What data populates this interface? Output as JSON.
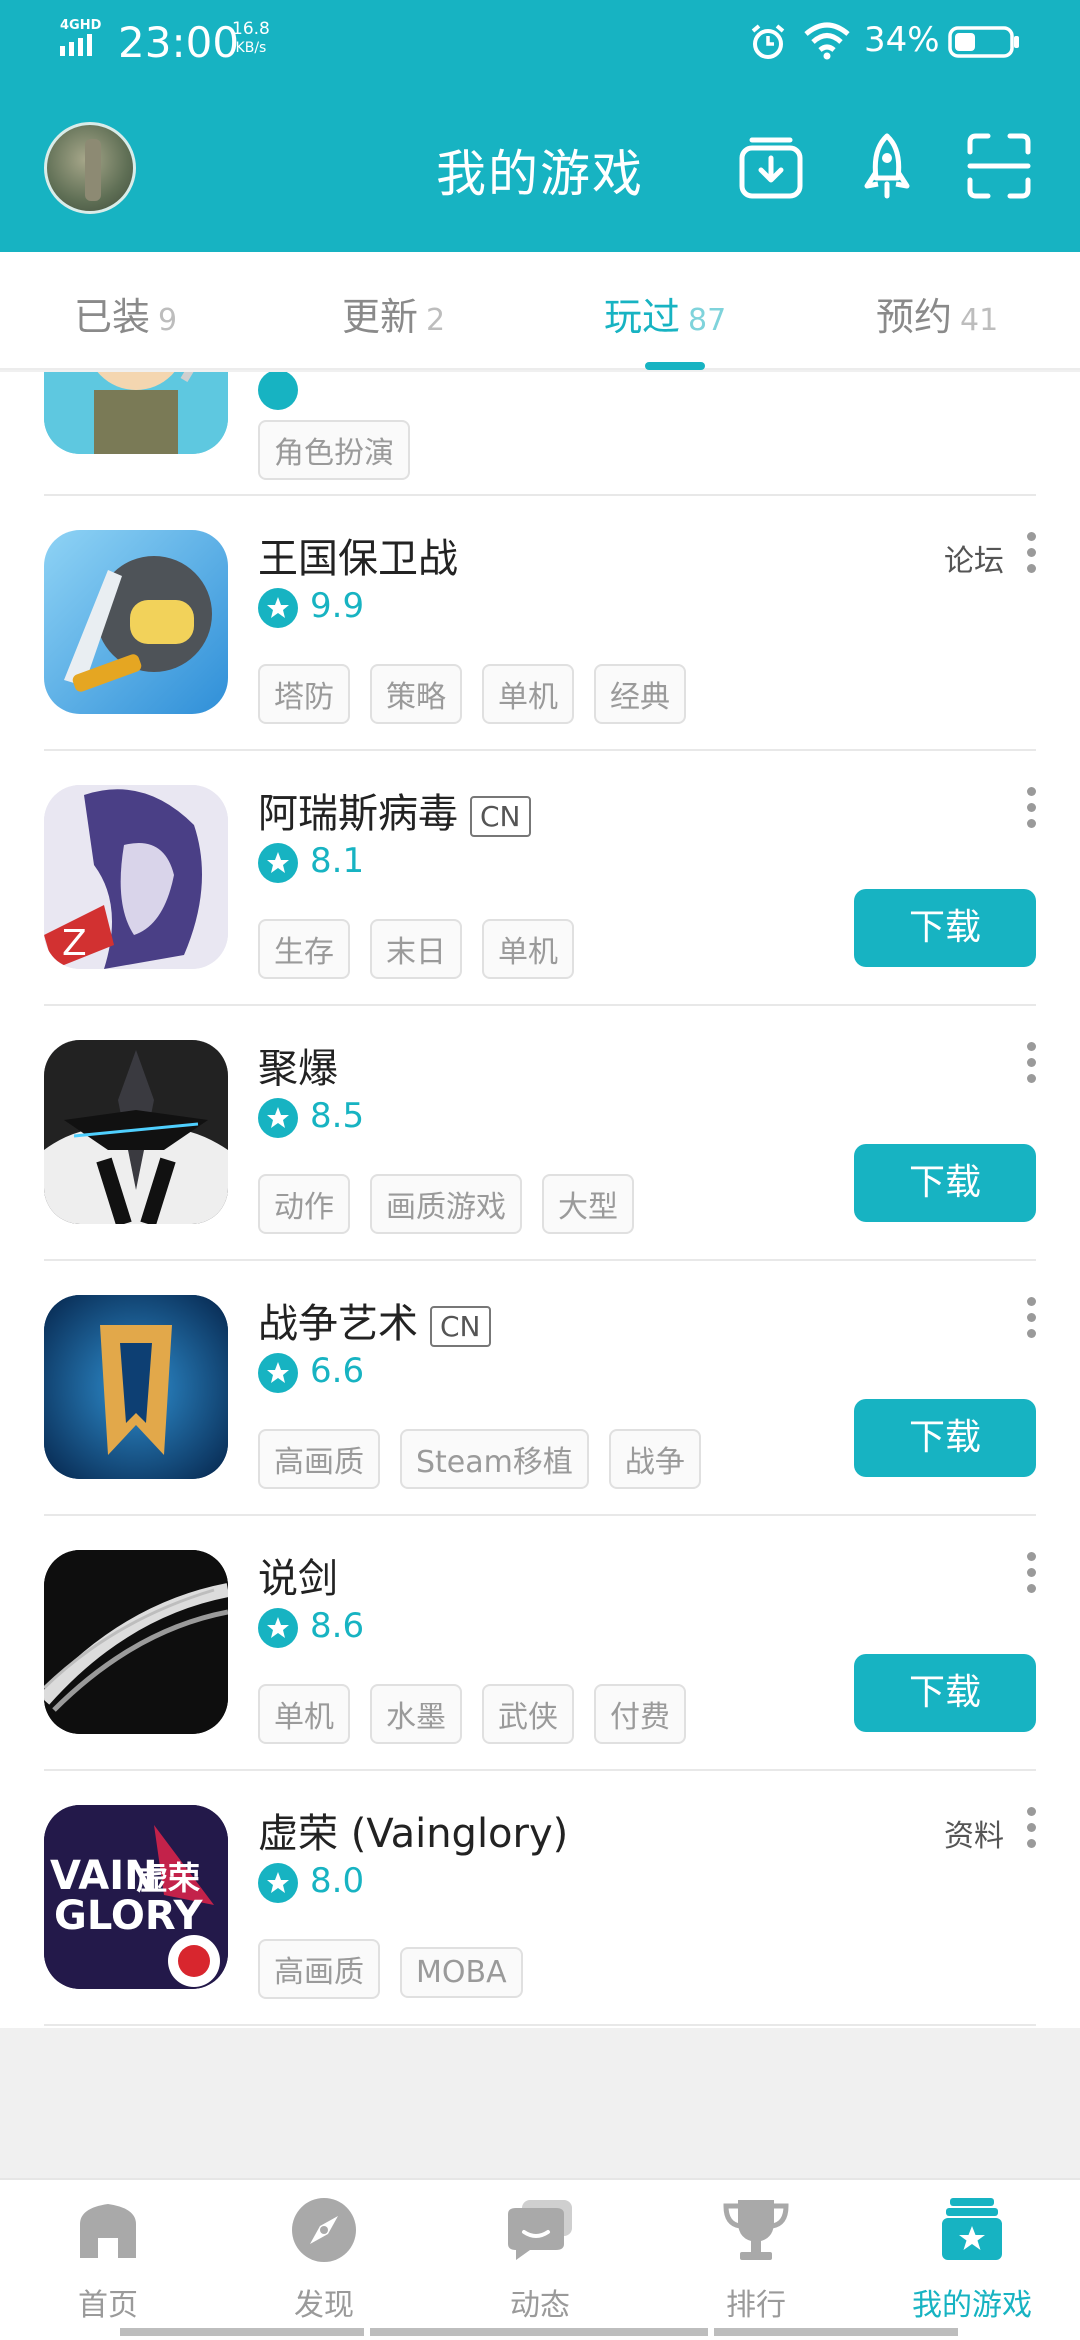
{
  "status_bar": {
    "network": "4GHD",
    "time": "23:00",
    "speed_value": "16.8",
    "speed_unit": "KB/s",
    "battery": "34%"
  },
  "header": {
    "title": "我的游戏"
  },
  "tabs": [
    {
      "label": "已装",
      "count": "9"
    },
    {
      "label": "更新",
      "count": "2"
    },
    {
      "label": "玩过",
      "count": "87"
    },
    {
      "label": "预约",
      "count": "41"
    }
  ],
  "list": {
    "partial_item": {
      "tags": [
        "角色扮演"
      ]
    },
    "items": [
      {
        "name": "王国保卫战",
        "cn": "",
        "rating": "9.9",
        "tags": [
          "塔防",
          "策略",
          "单机",
          "经典"
        ],
        "link": "论坛",
        "button": ""
      },
      {
        "name": "阿瑞斯病毒",
        "cn": "CN",
        "rating": "8.1",
        "tags": [
          "生存",
          "末日",
          "单机"
        ],
        "link": "",
        "button": "下载"
      },
      {
        "name": "聚爆",
        "cn": "",
        "rating": "8.5",
        "tags": [
          "动作",
          "画质游戏",
          "大型"
        ],
        "link": "",
        "button": "下载"
      },
      {
        "name": "战争艺术",
        "cn": "CN",
        "rating": "6.6",
        "tags": [
          "高画质",
          "Steam移植",
          "战争"
        ],
        "link": "",
        "button": "下载"
      },
      {
        "name": "说剑",
        "cn": "",
        "rating": "8.6",
        "tags": [
          "单机",
          "水墨",
          "武侠",
          "付费"
        ],
        "link": "",
        "button": "下载"
      },
      {
        "name": "虚荣 (Vainglory)",
        "cn": "",
        "rating": "8.0",
        "tags": [
          "高画质",
          "MOBA"
        ],
        "link": "资料",
        "button": ""
      }
    ]
  },
  "bottom_nav": [
    {
      "label": "首页",
      "icon": "home-icon"
    },
    {
      "label": "发现",
      "icon": "compass-icon"
    },
    {
      "label": "动态",
      "icon": "chat-icon"
    },
    {
      "label": "排行",
      "icon": "trophy-icon"
    },
    {
      "label": "我的游戏",
      "icon": "my-games-icon",
      "active": true
    }
  ],
  "colors": {
    "accent": "#17b3c2"
  },
  "logo_text": {
    "vainglory": "VAIN GLORY 虚荣"
  }
}
